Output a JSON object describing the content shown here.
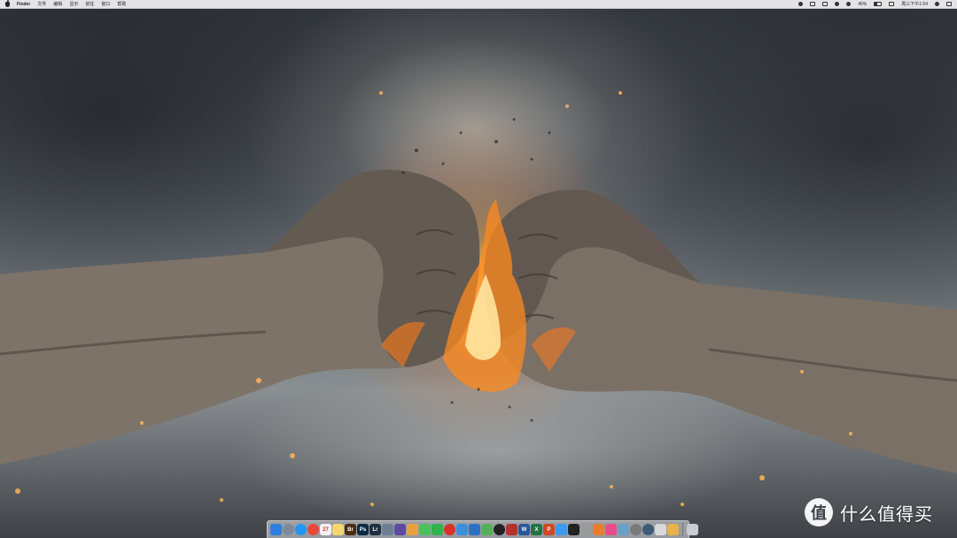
{
  "menubar": {
    "app_name": "Finder",
    "menus": [
      "文件",
      "编辑",
      "显示",
      "前往",
      "窗口",
      "帮助"
    ],
    "battery": "45%",
    "clock": "周三下午1:54"
  },
  "dock": {
    "items": [
      {
        "name": "finder-icon",
        "label": "",
        "color": "#2f7fe0"
      },
      {
        "name": "launchpad-icon",
        "label": "",
        "color": "#7c8a9a"
      },
      {
        "name": "safari-icon",
        "label": "",
        "color": "#2196f3"
      },
      {
        "name": "chrome-icon",
        "label": "",
        "color": "#e9483b"
      },
      {
        "name": "calendar-icon",
        "label": "27",
        "color": "#f4f4f4"
      },
      {
        "name": "notes-icon",
        "label": "",
        "color": "#f5d76e"
      },
      {
        "name": "bridge-icon",
        "label": "Br",
        "color": "#4b2d10"
      },
      {
        "name": "photoshop-icon",
        "label": "Ps",
        "color": "#0d2a45"
      },
      {
        "name": "lightroom-icon",
        "label": "Lr",
        "color": "#1b2f40"
      },
      {
        "name": "image-capture-icon",
        "label": "",
        "color": "#6b7f95"
      },
      {
        "name": "imovie-icon",
        "label": "",
        "color": "#5b4aa0"
      },
      {
        "name": "photos-icon",
        "label": "",
        "color": "#e7a23c"
      },
      {
        "name": "messages-icon",
        "label": "",
        "color": "#4ac15b"
      },
      {
        "name": "wechat-icon",
        "label": "",
        "color": "#2fb34a"
      },
      {
        "name": "netease-music-icon",
        "label": "",
        "color": "#d7332c"
      },
      {
        "name": "mail-icon",
        "label": "",
        "color": "#3b8fdc"
      },
      {
        "name": "keynote-icon",
        "label": "",
        "color": "#2b6fc7"
      },
      {
        "name": "maps-icon",
        "label": "",
        "color": "#55b05a"
      },
      {
        "name": "qq-icon",
        "label": "",
        "color": "#222222"
      },
      {
        "name": "photo-booth-icon",
        "label": "",
        "color": "#b3322d"
      },
      {
        "name": "word-icon",
        "label": "W",
        "color": "#2b579a"
      },
      {
        "name": "excel-icon",
        "label": "X",
        "color": "#217346"
      },
      {
        "name": "powerpoint-icon",
        "label": "P",
        "color": "#d24726"
      },
      {
        "name": "app-store-icon",
        "label": "",
        "color": "#3a9af0"
      },
      {
        "name": "terminal-icon",
        "label": "",
        "color": "#222222"
      },
      {
        "name": "pen-icon",
        "label": "",
        "color": "#9a9a9a"
      },
      {
        "name": "books-icon",
        "label": "",
        "color": "#e97d2f"
      },
      {
        "name": "music-icon",
        "label": "",
        "color": "#e84c8a"
      },
      {
        "name": "preview-icon",
        "label": "",
        "color": "#6aa0c8"
      },
      {
        "name": "system-preferences-icon",
        "label": "",
        "color": "#7a7a7a"
      },
      {
        "name": "activity-monitor-icon",
        "label": "",
        "color": "#3f5a78"
      },
      {
        "name": "textedit-icon",
        "label": "",
        "color": "#d9d9d9"
      },
      {
        "name": "pinwheel-icon",
        "label": "",
        "color": "#e9b14a"
      }
    ],
    "trash_name": "trash-icon"
  },
  "watermark": {
    "logo_text": "值",
    "text": "什么值得买"
  }
}
